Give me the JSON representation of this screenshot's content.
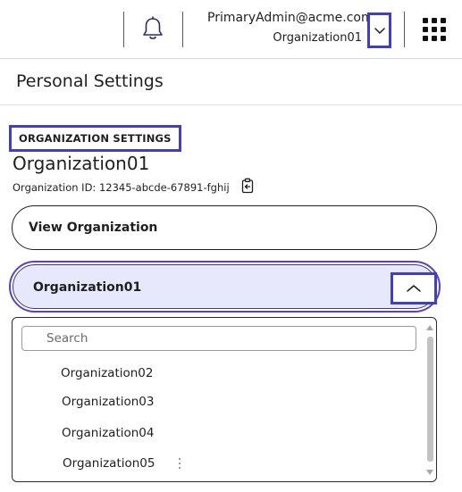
{
  "header": {
    "user_email": "PrimaryAdmin@acme.com",
    "user_org": "Organization01",
    "icons": {
      "notifications": "bell-icon",
      "account_toggle": "chevron-down-icon",
      "apps": "grid-icon"
    },
    "accent": "#3f3fbf"
  },
  "page": {
    "title": "Personal Settings"
  },
  "org_settings": {
    "label": "ORGANIZATION SETTINGS",
    "name": "Organization01",
    "id_text": "Organization ID: 12345-abcde-67891-fghij",
    "copy_icon": "clipboard-copy-icon",
    "view_button": "View Organization",
    "selector": {
      "value": "Organization01",
      "toggle_icon": "chevron-up-icon",
      "fill": "#e7e8fb",
      "ring": "#5b3fc4"
    },
    "dropdown": {
      "search_placeholder": "Search",
      "options": [
        "Organization02",
        "Organization03",
        "Organization04",
        "Organization05"
      ]
    }
  }
}
